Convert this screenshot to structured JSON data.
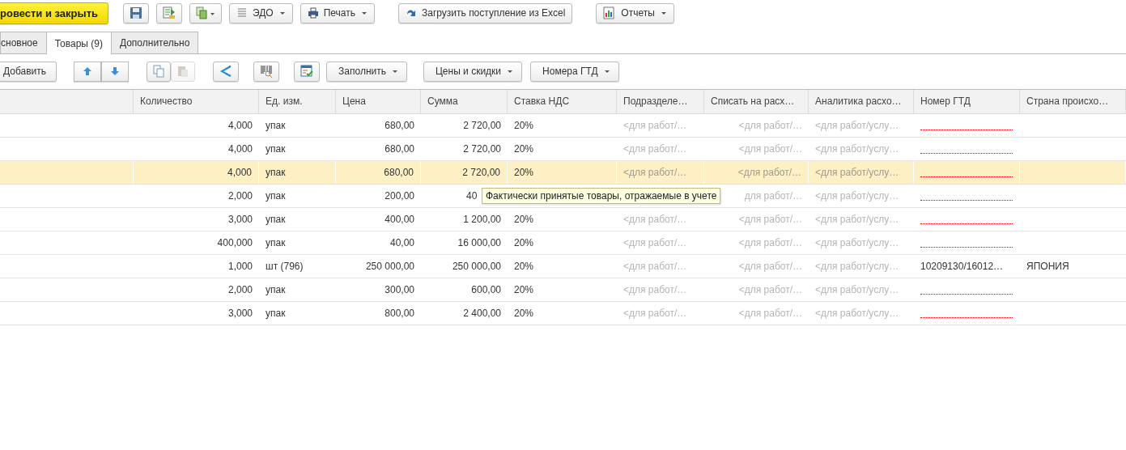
{
  "toolbar": {
    "post_close": "ровести и закрыть",
    "edo": "ЭДО",
    "print": "Печать",
    "load_excel": "Загрузить поступление из Excel",
    "reports": "Отчеты"
  },
  "tabs": [
    {
      "label": "сновное",
      "selected": false
    },
    {
      "label": "Товары (9)",
      "selected": true
    },
    {
      "label": "Дополнительно",
      "selected": false
    }
  ],
  "table_toolbar": {
    "add": "Добавить",
    "paste_disabled": true,
    "fill": "Заполнить",
    "prices": "Цены и скидки",
    "gtd_numbers": "Номера ГТД"
  },
  "table": {
    "columns": [
      "Количество",
      "Ед. изм.",
      "Цена",
      "Сумма",
      "Ставка НДС",
      "Подразделе…",
      "Списать на расх…",
      "Аналитика расхо…",
      "Номер ГТД",
      "Страна происхо…"
    ],
    "rows": [
      {
        "selected": false,
        "qty": "4,000",
        "unit": "упак",
        "price": "680,00",
        "sum": "2 720,00",
        "vat": "20%",
        "dept": "<для работ/…",
        "writeoff": "<для работ/…",
        "analytics": "<для работ/услу…",
        "gtd": {
          "missing": true
        }
      },
      {
        "selected": false,
        "qty": "4,000",
        "unit": "упак",
        "price": "680,00",
        "sum": "2 720,00",
        "vat": "20%",
        "dept": "<для работ/…",
        "writeoff": "<для работ/…",
        "analytics": "<для работ/услу…",
        "gtd": {
          "missing": true
        }
      },
      {
        "selected": true,
        "qty": "4,000",
        "unit": "упак",
        "price": "680,00",
        "sum": "2 720,00",
        "vat": "20%",
        "dept": "<для работ/…",
        "writeoff": "<для работ/…",
        "analytics": "<для работ/услу…",
        "gtd": {
          "missing": true
        }
      },
      {
        "selected": false,
        "qty": "2,000",
        "unit": "упак",
        "price": "200,00",
        "sum": "40",
        "tooltip": "Фактически принятые товары, отражаемые в учете",
        "writeoff": "для работ/…",
        "analytics": "<для работ/услу…",
        "gtd": {
          "missing": true
        }
      },
      {
        "selected": false,
        "qty": "3,000",
        "unit": "упак",
        "price": "400,00",
        "sum": "1 200,00",
        "vat": "20%",
        "dept": "<для работ/…",
        "writeoff": "<для работ/…",
        "analytics": "<для работ/услу…",
        "gtd": {
          "missing": true
        }
      },
      {
        "selected": false,
        "qty": "400,000",
        "unit": "упак",
        "price": "40,00",
        "sum": "16 000,00",
        "vat": "20%",
        "dept": "<для работ/…",
        "writeoff": "<для работ/…",
        "analytics": "<для работ/услу…",
        "gtd": {
          "missing": true
        }
      },
      {
        "selected": false,
        "qty": "1,000",
        "unit": "шт (796)",
        "price": "250 000,00",
        "sum": "250 000,00",
        "vat": "20%",
        "dept": "<для работ/…",
        "writeoff": "<для работ/…",
        "analytics": "<для работ/услу…",
        "gtd": {
          "missing": false,
          "value": "10209130/16012…"
        },
        "country": "ЯПОНИЯ"
      },
      {
        "selected": false,
        "qty": "2,000",
        "unit": "упак",
        "price": "300,00",
        "sum": "600,00",
        "vat": "20%",
        "dept": "<для работ/…",
        "writeoff": "<для работ/…",
        "analytics": "<для работ/услу…",
        "gtd": {
          "missing": true
        }
      },
      {
        "selected": false,
        "qty": "3,000",
        "unit": "упак",
        "price": "800,00",
        "sum": "2 400,00",
        "vat": "20%",
        "dept": "<для работ/…",
        "writeoff": "<для работ/…",
        "analytics": "<для работ/услу…",
        "gtd": {
          "missing": true
        }
      }
    ]
  }
}
